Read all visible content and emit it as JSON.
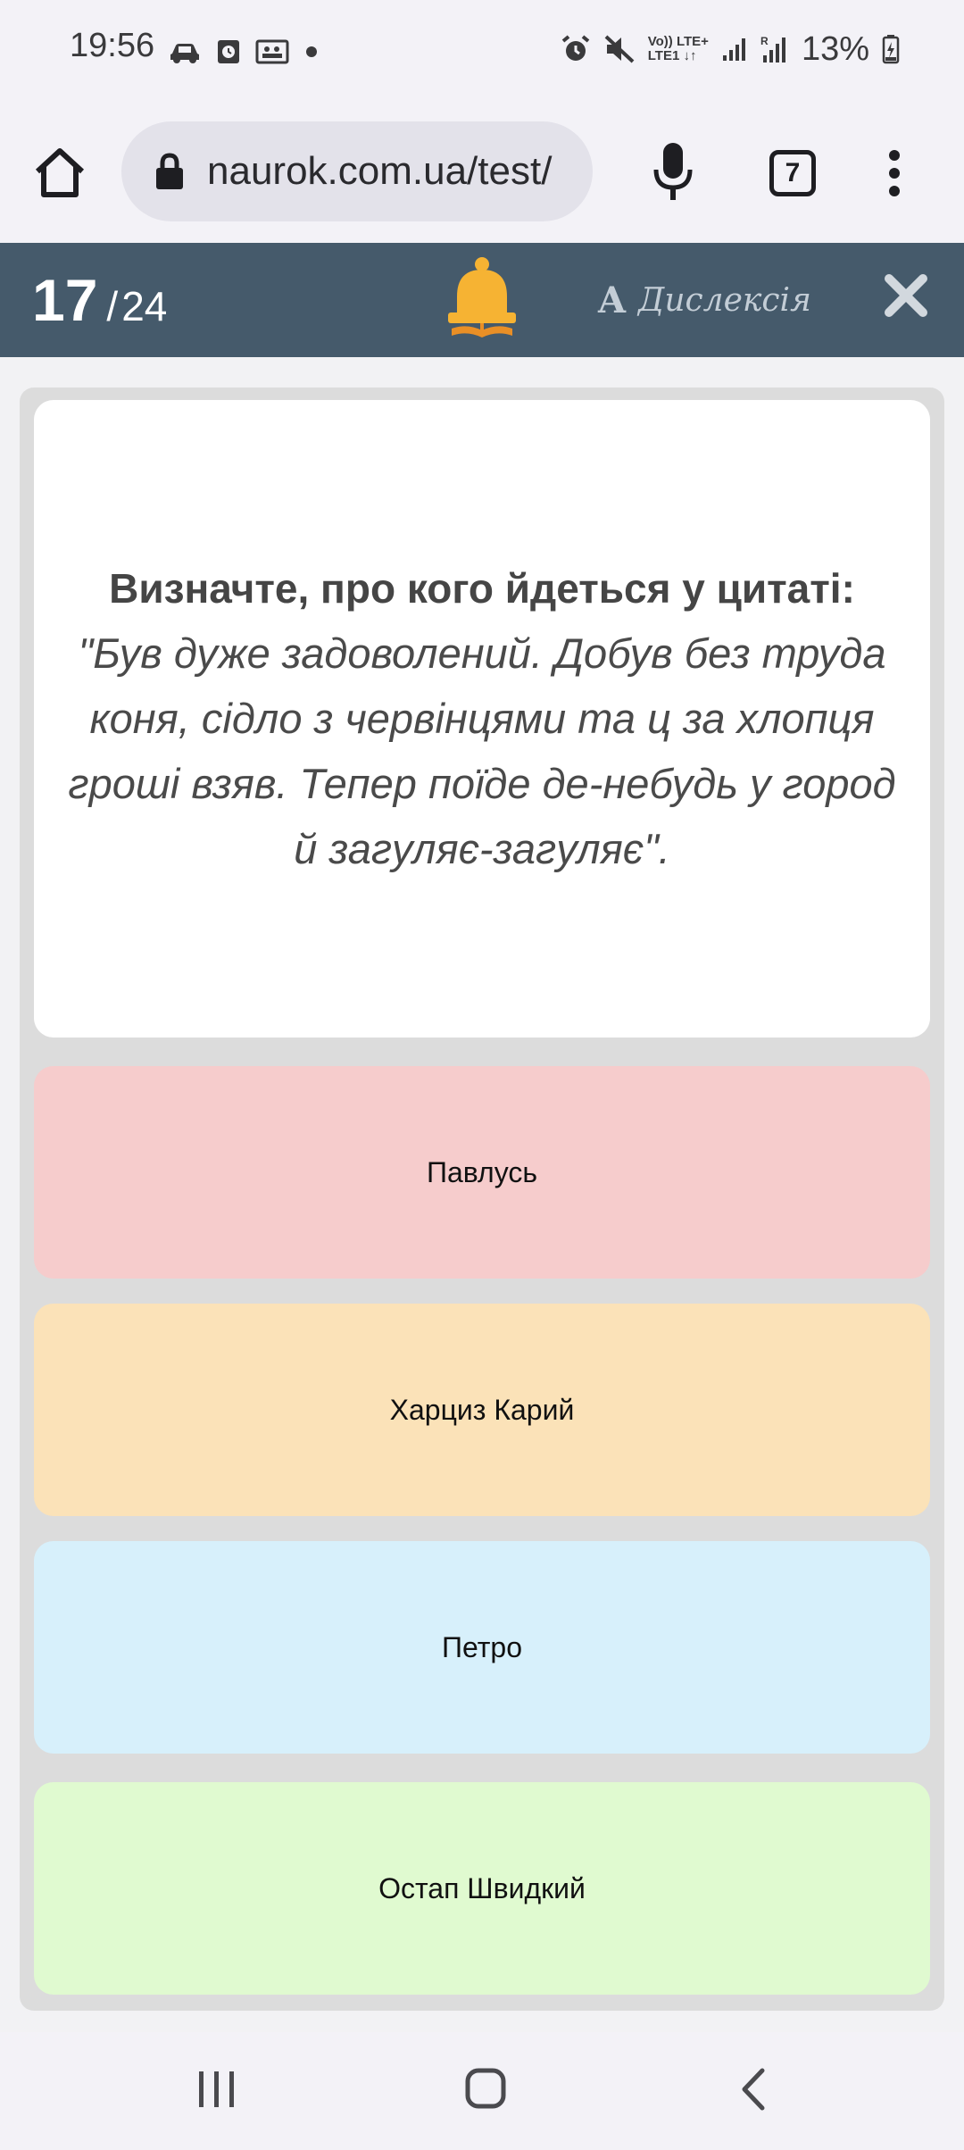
{
  "status_bar": {
    "time": "19:56",
    "battery": "13%",
    "lte_top": "Vo)) LTE+",
    "lte_bottom": "LTE1 ↓↑",
    "left_icons": [
      "car-icon",
      "clock-app-icon",
      "gallery-icon",
      "dot-icon"
    ],
    "right_icons": [
      "alarm-icon",
      "mute-icon",
      "signal-icon",
      "signal-roaming-icon",
      "battery-charging-icon"
    ]
  },
  "browser": {
    "url": "naurok.com.ua/test/",
    "tab_count": "7",
    "icons": [
      "home-icon",
      "lock-icon",
      "mic-icon",
      "more-vert-icon"
    ]
  },
  "quiz_header": {
    "current": "17",
    "separator": "/",
    "total": "24",
    "dyslexia_icon_letter": "A",
    "dyslexia_label": "Дислексія",
    "icons": [
      "bell-icon",
      "close-icon"
    ],
    "accent_color": "#455a6b",
    "bell_color": "#f6b333"
  },
  "question": {
    "title": "Визначте, про кого йдеться у цитаті:",
    "quote": "\"Був дуже задоволений. Добув без труда коня, сідло з червінцями та ц за хлопця гроші взяв. Тепер поїде де-небудь у город й загуляє-загуляє\"."
  },
  "answers": [
    {
      "label": "Павлусь",
      "color": "#f6cccc"
    },
    {
      "label": "Харциз Карий",
      "color": "#fbe2b8"
    },
    {
      "label": "Петро",
      "color": "#d7f0fb"
    },
    {
      "label": "Остап Швидкий",
      "color": "#e0fad0"
    }
  ],
  "nav_bar": {
    "icons": [
      "recent-apps-icon",
      "home-circle-icon",
      "back-icon"
    ]
  }
}
